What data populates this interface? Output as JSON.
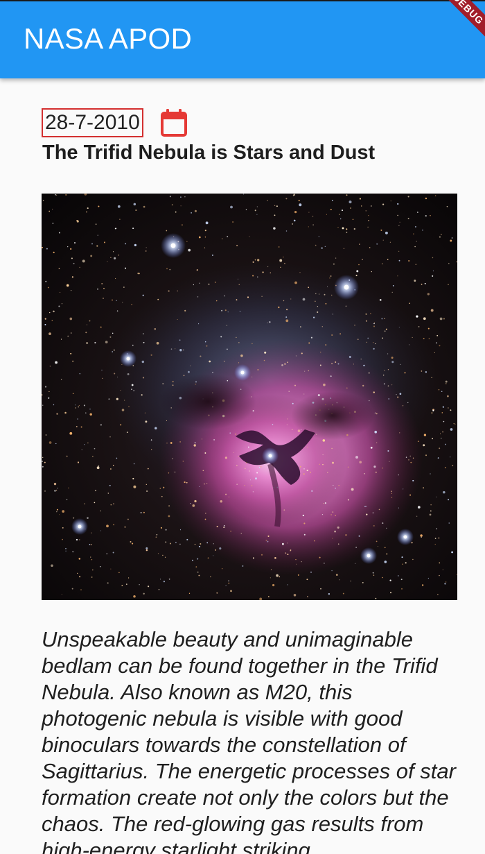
{
  "appbar": {
    "title": "NASA APOD",
    "debug_label": "DEBUG",
    "color": "#2196f3"
  },
  "apod": {
    "date": "28-7-2010",
    "calendar_icon": "calendar-icon",
    "title": "The Trifid Nebula is Stars and Dust",
    "image_alt": "Trifid Nebula (M20) photograph",
    "explanation": "Unspeakable beauty and unimaginable bedlam can be found together in the Trifid Nebula. Also known as M20, this photogenic nebula is visible with good binoculars towards the constellation of Sagittarius. The energetic processes of star formation create not only the colors but the chaos. The red-glowing gas results from high-energy starlight striking"
  },
  "colors": {
    "accent": "#2196f3",
    "date_border": "#d32f2f",
    "calendar_icon": "#e53935",
    "debug_banner": "#a11d2a"
  }
}
